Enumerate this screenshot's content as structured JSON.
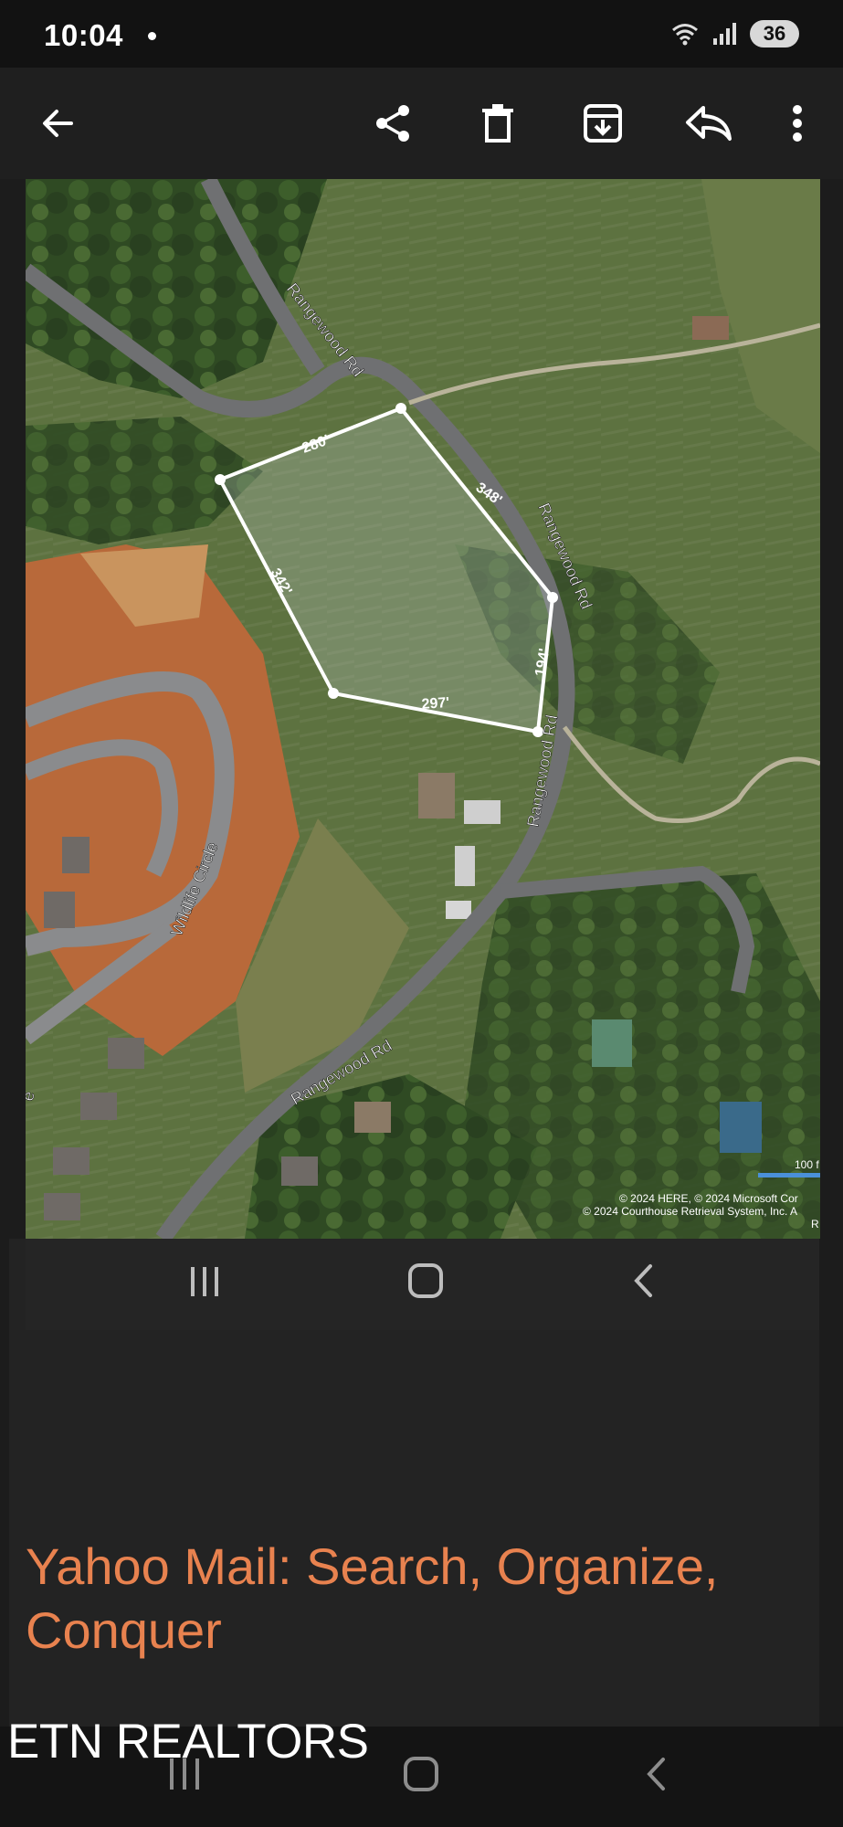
{
  "status_bar": {
    "time": "10:04",
    "battery": "36"
  },
  "toolbar": {
    "back_icon": "arrow-left-icon",
    "share_icon": "share-icon",
    "delete_icon": "trash-icon",
    "archive_icon": "archive-icon",
    "reply_icon": "reply-icon",
    "more_icon": "more-vertical-icon"
  },
  "map": {
    "road_labels": [
      "Rangewood Rd",
      "Rangewood Rd",
      "Rangewood Rd",
      "Rangewood Rd",
      "Wildlife Circle",
      "e"
    ],
    "parcel_dimensions": [
      "280'",
      "348'",
      "342'",
      "194'",
      "297'"
    ],
    "scale_label": "100 f",
    "copyright_lines": [
      "© 2024 HERE, © 2024 Microsoft Cor",
      "© 2024 Courthouse Retrieval System, Inc. A",
      "R"
    ],
    "colors": {
      "parcel_outline": "#ffffff",
      "road": "#6f7072",
      "dirt": "#b8693a",
      "vegetation": "#3f5a2c"
    }
  },
  "nav_inner": {
    "recents_icon": "recents-icon",
    "home_icon": "home-icon",
    "back_icon": "chevron-left-icon"
  },
  "promo": {
    "title": "Yahoo Mail: Search, Organize, Conquer",
    "color": "#e8824f"
  },
  "watermark": {
    "text": "ETN REALTORS"
  },
  "nav_bottom": {
    "recents_icon": "recents-icon",
    "home_icon": "home-icon",
    "back_icon": "chevron-left-icon"
  }
}
